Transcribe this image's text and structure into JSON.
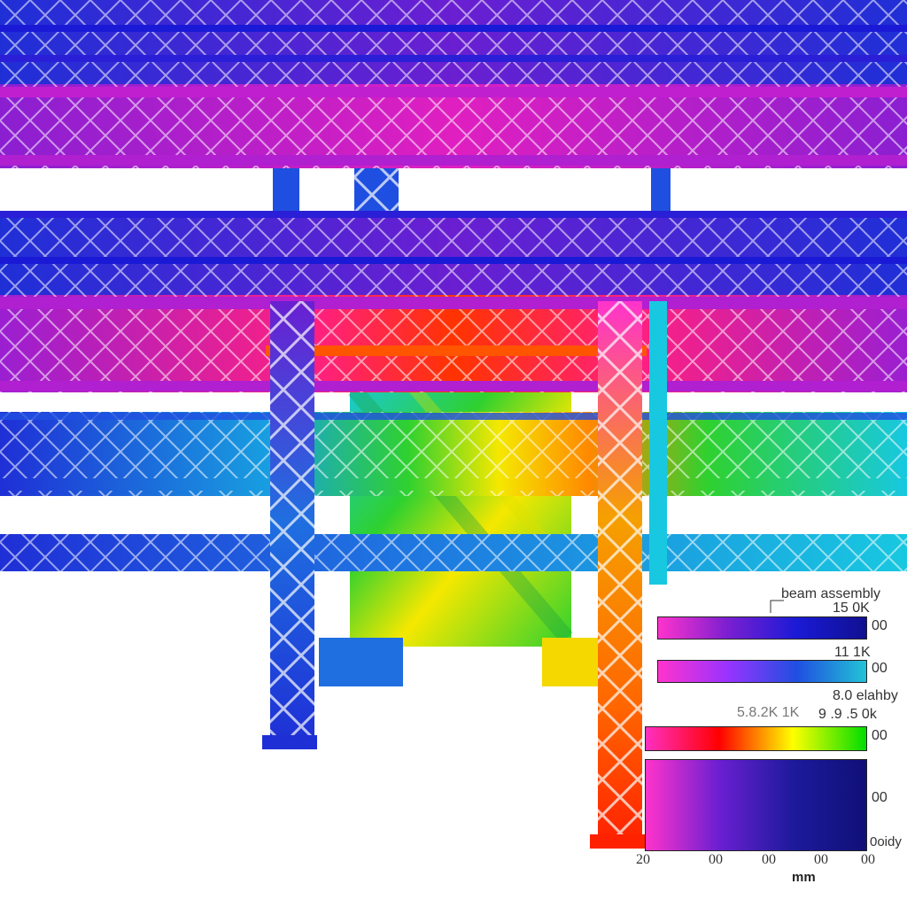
{
  "legend": {
    "title": "beam assembly",
    "bars": [
      {
        "top_label": "15 0K",
        "right_label": "00",
        "colors": [
          "#ff33cc",
          "#7b1fd1",
          "#1a1ad6",
          "#101090"
        ]
      },
      {
        "top_label": "11 1K",
        "right_label": "00",
        "colors": [
          "#ff33cc",
          "#9933ff",
          "#1f4fe0",
          "#22c3d6"
        ]
      },
      {
        "top_label": "8.0 elahby",
        "left_label": "5.8.2K 1K",
        "mid_label": "9 .9 .5 0k",
        "right_label": "00",
        "colors": [
          "#ff2fc0",
          "#ff0000",
          "#ffff00",
          "#00dd00"
        ]
      },
      {
        "right_label": "00",
        "colors": [
          "#ff33cc",
          "#6a1fd1",
          "#1d1a9c",
          "#101078"
        ]
      }
    ],
    "side_label": "0oidy",
    "axis_ticks": [
      "20",
      "00",
      "00",
      "00",
      "00"
    ],
    "unit": "mm"
  },
  "colors": {
    "blue": "#1f2fd6",
    "cyan": "#18c8e0",
    "magenta": "#d21fc8",
    "purple": "#7a1fd1",
    "red": "#ff2200",
    "orange": "#ff8800",
    "yellow": "#f5e800",
    "green": "#2fd12f"
  }
}
